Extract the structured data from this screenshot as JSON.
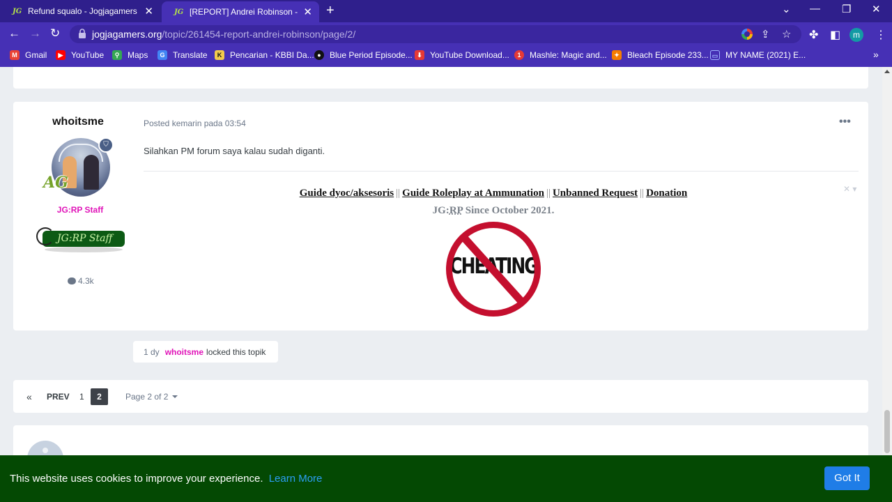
{
  "browser": {
    "tabs": [
      {
        "title": "Refund squalo - Jogjagamers Com",
        "active": false
      },
      {
        "title": "[REPORT] Andrei Robinson - Page",
        "active": true
      }
    ],
    "url_host": "jogjagamers.org",
    "url_path": "/topic/261454-report-andrei-robinson/page/2/",
    "profile_initial": "m",
    "bookmarks": [
      {
        "label": "Gmail",
        "icon": "gmail-icon",
        "color": "#ea4335"
      },
      {
        "label": "YouTube",
        "icon": "youtube-icon",
        "color": "#ff0000"
      },
      {
        "label": "Maps",
        "icon": "maps-icon",
        "color": "#34a853"
      },
      {
        "label": "Translate",
        "icon": "translate-icon",
        "color": "#4285f4"
      },
      {
        "label": "Pencarian - KBBI Da...",
        "icon": "kbbi-icon",
        "color": "#1a1a1a"
      },
      {
        "label": "Blue Period Episode...",
        "icon": "anime-icon",
        "color": "#111111"
      },
      {
        "label": "YouTube Download...",
        "icon": "download-icon",
        "color": "#e53935"
      },
      {
        "label": "Mashle: Magic and...",
        "icon": "mashle-icon",
        "color": "#e53935"
      },
      {
        "label": "Bleach Episode 233...",
        "icon": "bleach-icon",
        "color": "#f57c00"
      },
      {
        "label": "MY NAME (2021) E...",
        "icon": "tv-icon",
        "color": "#6e8cff"
      }
    ]
  },
  "post": {
    "author": "whoitsme",
    "role": "JG:RP Staff",
    "staff_banner_text": "JG:RP Staff",
    "post_count": "4.3k",
    "meta": "Posted kemarin pada 03:54",
    "body": "Silahkan PM forum saya kalau sudah diganti.",
    "signature": {
      "links": [
        "Guide dyoc/aksesoris",
        "Guide Roleplay at Ammunation",
        "Unbanned Request",
        "Donation"
      ],
      "since_prefix": "JG:",
      "since_rp": "RP",
      "since_suffix": " Since October 2021.",
      "image_text": "CHEATING"
    }
  },
  "lock_event": {
    "time": "1 dy",
    "user": "whoitsme",
    "action": "locked this topik"
  },
  "pagination": {
    "prev": "PREV",
    "pages": [
      "1",
      "2"
    ],
    "current": "2",
    "page_of": "Page 2 of 2"
  },
  "cookie": {
    "text": "This website uses cookies to improve your experience.",
    "learn_more": "Learn More",
    "button": "Got It"
  }
}
